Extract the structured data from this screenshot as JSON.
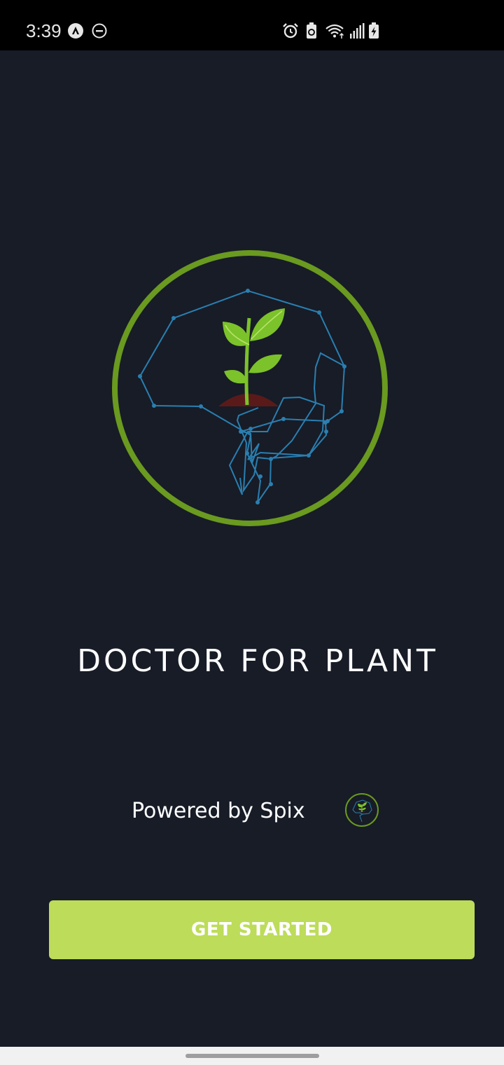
{
  "status_bar": {
    "time": "3:39",
    "left_icons": [
      "navigation-a-icon",
      "do-not-disturb-icon"
    ],
    "right_icons": [
      "alarm-icon",
      "battery-saver-icon",
      "wifi-icon",
      "signal-icon",
      "battery-charging-icon"
    ]
  },
  "splash": {
    "logo_icon": "brain-plant-logo-icon",
    "title": "DOCTOR FOR PLANT",
    "powered_by": "Powered by Spix",
    "powered_logo_icon": "spix-logo-icon",
    "cta_label": "GET STARTED"
  },
  "colors": {
    "background": "#171c27",
    "status_bar": "#000000",
    "ring": "#6a9a1f",
    "network_lines": "#2a7fb0",
    "leaf": "#7cc22a",
    "soil": "#5a1a1a",
    "button": "#bddc5a",
    "nav_bar": "#f1f1f1"
  }
}
